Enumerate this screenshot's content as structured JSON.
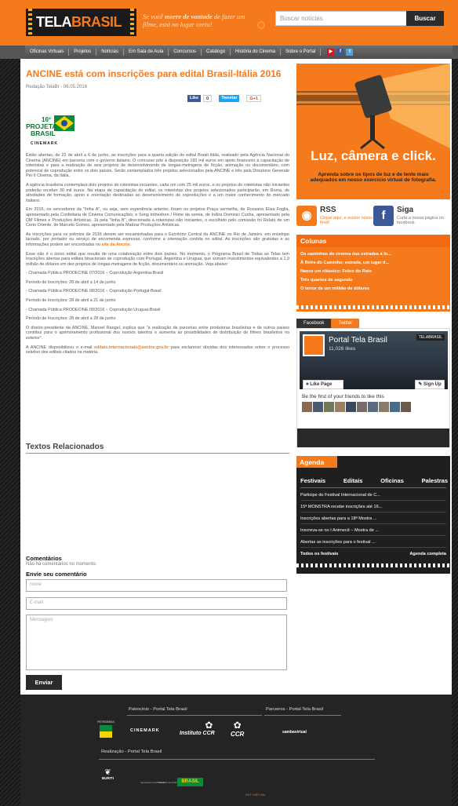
{
  "header": {
    "logo_tela": "TELA",
    "logo_brasil": "BRASIL",
    "slogan_a": "Se você ",
    "slogan_b": "morre de vontade",
    "slogan_c": " de fazer um filme, está no lugar certo!",
    "search_placeholder": "Buscar notícias",
    "search_button": "Buscar"
  },
  "nav": {
    "items": [
      "Oficinas Virtuais",
      "Projetos",
      "Notícias",
      "Em Sala de Aula",
      "Concursos",
      "Catálogo",
      "História do Cinema",
      "Sobre o Portal"
    ]
  },
  "colors": {
    "accent": "#f47a1c",
    "dark": "#2b2b2b",
    "facebook": "#3b5998",
    "twitter": "#1da1f2",
    "youtube": "#cc181e"
  },
  "article": {
    "title": "ANCINE está com inscrições para edital Brasil-Itália 2016",
    "meta": "Redação TelaBr - 06.05.2016",
    "share": {
      "like": "Like",
      "like_count": "0",
      "tweet": "Tweetar",
      "gplus": "G+1"
    },
    "logo": {
      "number": "16º",
      "line1": "PROJETA",
      "line2": "BRASIL",
      "line3": "CINEMARK"
    },
    "paragraphs": [
      "Estão abertas, de 22 de abril a 6 de junho, as inscrições para a quarta edição do edital Brasil-Itália, realizado pela Agência Nacional do Cinema (ANCINE) em parceria com o governo italiano. O concurso põe à disposição 160 mil euros em apoio financeiro à capacitação de roteiristas e para a realização de seis projetos de desenvolvimento de longas-metragens de ficção, animação ou documentário, com potencial de coprodução entre os dois países. Serão contemplados três projetos selecionados pela ANCINE e três pela Direzione Generale Per Il Cinema, da Itália.",
      "A agência brasileira contemplará dois projetos de roteiristas iniciantes, cada um com 25 mil euros, e os projetos de roteiristas não iniciantes poderão receber 30 mil euros. Na etapa de capacitação do edital, os roteiristas dos projetos selecionados participarão, em Roma, de atividades de formação, apoio e orientação destinadas ao desenvolvimento de coproduções e a um maior conhecimento do mercado italiano.",
      "Em 2015, os vencedores da \"linha A\", ou seja, sem experiência anterior, foram os projetos Praça vermelha, de Rossana Elisa Foglia, apresentado pela Confeitaria de Cinema Comunicações; e Song tothestren / Filme da sereia, de Indira Dominici Cunha, apresentado pela DM Filmes e Produções Artísticas. Já pela \"linha B\", direcionada a roteiristas não iniciantes, o escolhido pelo comissão foi Relato de um Certo Oriente, de Marcelo Gomes, apresentado pela Matizar Produções Artísticas."
    ],
    "p4_text": "As inscrições para os prêmios de 2016 devem ser encaminhadas para o Escritório Central da ANCINE no Rio de Janeiro, em envelope lacrado, por portador ou serviço de encomenda expressa, conforme a orientação contida no edital. As inscrições são gratuitas e as informações podem ser encontradas no ",
    "p4_link": "site da Ancine",
    "p4_end": ".",
    "paragraphs2": [
      "Esse não é o único edital que resulta de uma colaboração entre dois países. No momento, o Programa Brasil de Todas as Telas tem inscrições abertas para editais binacionais de coprodução com Portugal, Argentina e Uruguai, que somam investimentos equivalentes a 1,9 milhão de dólares em dez projetos de longas-metragens de ficção, documentário ou animação. Veja abaixo:",
      "- Chamada Pública PRODECINE 07/2016 – Coprodução Argentina-Brasil",
      "Período de Inscrições: 28 de abril a 14 de junho",
      "- Chamada Pública PRODECINE 08/2016 – Coprodução Portugal-Brasil",
      "Período de Inscrições: 28 de abril a 21 de junho",
      "- Chamada Pública PRODECINE 09/2016 – Coprodução Uruguai-Brasil",
      "Período de Inscrições: 28 de abril a 28 de junho",
      "O diretor-presidente da ANCINE, Manoel Rangel, explica que \"a realização de parcerias entre produtoras brasileiras e de outros países contribui para o aprimoramento profissional dos nossos talentos e aumenta as possibilidades de distribuição de filmes brasileiros no exterior\"."
    ],
    "p_last_a": "A ANCINE disponibilizou o e-mail ",
    "p_last_email": "editais.internacionais@ancine.gov.br",
    "p_last_b": " para esclarecer dúvidas dos interessados sobre o processo seletivo dos editais citados na matéria."
  },
  "related": {
    "title": "Textos Relacionados"
  },
  "comments": {
    "title": "Comentários",
    "none": "Não há comentários no momento.",
    "send_title": "Envie seu comentário",
    "name_placeholder": "nome",
    "email_placeholder": "E-mail",
    "message_placeholder": "Mensagem",
    "submit": "Enviar"
  },
  "sidebar": {
    "ad": {
      "headline": "Luz, câmera e click.",
      "sub": "Aprenda sobre os tipos de luz e de lente mais adequados em nosso exercício virtual de fotografia."
    },
    "rss": {
      "title": "RSS",
      "link": "Clique aqui",
      "desc": ", e assine nosso feed!"
    },
    "siga": {
      "title": "Siga",
      "desc": "Curta a nossa página no facebook."
    },
    "colunas": {
      "title": "Colunas",
      "items": [
        "Os caminhos do cinema das estradas à In...",
        "À Beira do Caminho: estrada, um lugar d...",
        "Nasce um clássico: Febre do Rato",
        "Três quartos de segundo",
        "O terror de um milhão de dólares"
      ]
    },
    "facebook": {
      "tab_fb": "Facebook",
      "tab_tw": "Twitter",
      "page_name": "Portal Tela Brasil",
      "likes": "11,026 likes",
      "like_page": "Like Page",
      "sign_up": "Sign Up",
      "first_friends": "Be the first of your friends to like this",
      "cover_badge": "TELABRASIL"
    },
    "agenda": {
      "title": "Agenda",
      "tabs": [
        "Festivais",
        "Editais",
        "Oficinas",
        "Palestras"
      ],
      "items": [
        "Participe do Festival Internacional de C...",
        "15ª MONSTRA recebe inscrições até 16...",
        "Inscrições abertas para a 18ª Mostra ...",
        "Inscreva-se no I Animecê – Mostra de ...",
        "Abertas as inscrições para o festival ..."
      ],
      "all_festivals": "Todos os festivais",
      "full_agenda": "Agenda completa"
    }
  },
  "footer": {
    "sponsor_title": "Patrocínio - Portal Tela Brasil",
    "partners_title": "Parceiros - Portal Tela Brasil",
    "realization_title": "Realização - Portal Tela Brasil",
    "logos": {
      "petrobras": "PETROBRAS",
      "cinemark": "CINEMARK",
      "instituto_ccr": "Instituto CCR",
      "ccr": "CCR",
      "sambavirtual": "sambavirtual",
      "buriti": "BURITI",
      "audiovisual": "Secretaria do Audiovisual",
      "cultura": "Ministério da Cultura",
      "brasil": "BRASIL"
    },
    "dev": "DV7 VIRTUAL"
  }
}
